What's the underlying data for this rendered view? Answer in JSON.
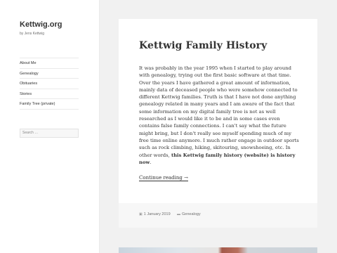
{
  "site": {
    "title": "Kettwig.org",
    "description": "by Jens Kettwig"
  },
  "nav": {
    "items": [
      {
        "label": "About Me"
      },
      {
        "label": "Genealogy"
      },
      {
        "label": "Obituaries"
      },
      {
        "label": "Stories"
      },
      {
        "label": "Family Tree (private)"
      }
    ]
  },
  "search": {
    "placeholder": "Search …"
  },
  "post": {
    "title": "Kettwig Family History",
    "body": "It was probably in the year 1995 when I started to play around with genealogy, trying out the first basic software at that time. Over the years I have gathered a great amount of information, mainly data of deceased people who were somehow connected to different Kettwig families. Truth is that I have not done anything genealogy related in many years and I am aware of the fact that some information on my digital family tree is not as well researched as I would like it to be and in some cases even contains false family connections. I can't say what the future might bring, but I don't really see myself spending much of my free time online anymore. I much rather engage in outdoor sports such as rock climbing, hiking, skitouring, snowshoeing, etc. In other words, ",
    "body_bold": "this Kettwig family history (website) is history now",
    "body_end": ".",
    "continue_label": "Continue reading →",
    "date": "1 January 2019",
    "category": "Genealogy",
    "date_icon": "calendar-icon",
    "category_icon": "folder-icon"
  },
  "colors": {
    "background": "#f1f1f1",
    "panel": "#ffffff",
    "text": "#333333",
    "muted": "#707070"
  }
}
